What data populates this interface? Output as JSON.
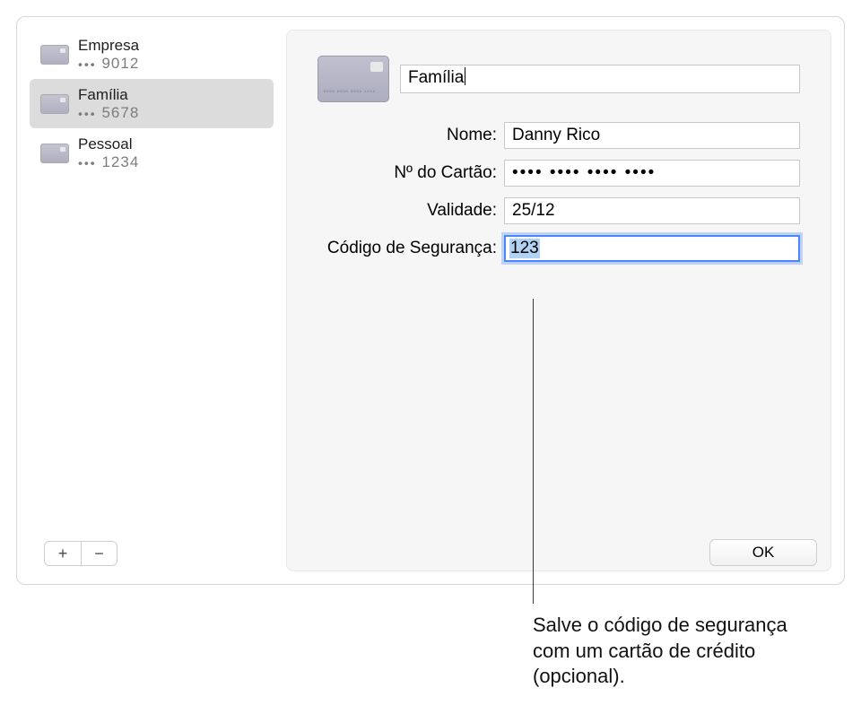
{
  "sidebar": {
    "items": [
      {
        "title": "Empresa",
        "masked": "9012",
        "selected": false
      },
      {
        "title": "Família",
        "masked": "5678",
        "selected": true
      },
      {
        "title": "Pessoal",
        "masked": "1234",
        "selected": false
      }
    ]
  },
  "detail": {
    "description": "Família",
    "labels": {
      "name": "Nome:",
      "number": "Nº do Cartão:",
      "expiry": "Validade:",
      "security": "Código de Segurança:"
    },
    "values": {
      "name": "Danny Rico",
      "number_masked": "•••• •••• •••• ••••",
      "expiry": "25/12",
      "security": "123"
    }
  },
  "footer": {
    "add": "+",
    "remove": "−",
    "ok": "OK"
  },
  "callout": "Salve o código de segurança com um cartão de crédito (opcional)."
}
